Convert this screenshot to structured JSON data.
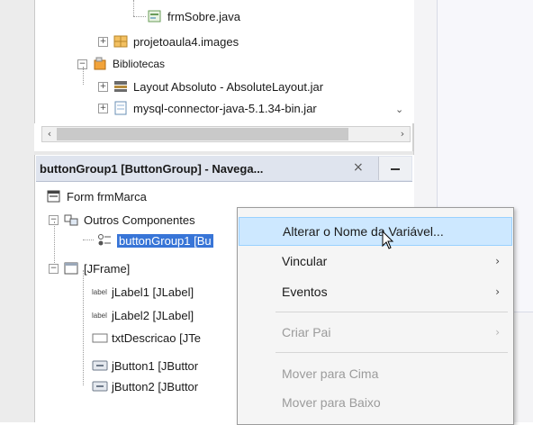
{
  "project_tree": {
    "items": [
      {
        "label": "frmSobre.java",
        "icon": "java-form-icon"
      },
      {
        "label": "projetoaula4.images",
        "icon": "package-icon"
      },
      {
        "label": "Bibliotecas",
        "icon": "libraries-icon"
      },
      {
        "label": "Layout Absoluto - AbsoluteLayout.jar",
        "icon": "jar-icon"
      },
      {
        "label": "mysql-connector-java-5.1.34-bin.jar",
        "icon": "jar-icon"
      }
    ]
  },
  "navigator": {
    "title": "buttonGroup1 [ButtonGroup] - Navega...",
    "close": "×",
    "minimize": "—",
    "items": [
      {
        "label": "Form frmMarca"
      },
      {
        "label": "Outros Componentes"
      },
      {
        "label": "buttonGroup1 [Bu"
      },
      {
        "label": "[JFrame]"
      },
      {
        "label": "jLabel1 [JLabel]",
        "tag": "label"
      },
      {
        "label": "jLabel2 [JLabel]",
        "tag": "label"
      },
      {
        "label": "txtDescricao [JTe"
      },
      {
        "label": "jButton1 [JButtor"
      },
      {
        "label": "jButton2 [JButtor"
      }
    ]
  },
  "context_menu": {
    "items": [
      {
        "label": "Alterar o Nome da Variável...",
        "enabled": true,
        "hover": true,
        "submenu": false
      },
      {
        "label": "Vincular",
        "enabled": true,
        "submenu": true
      },
      {
        "label": "Eventos",
        "enabled": true,
        "submenu": true
      },
      {
        "label": "Criar Pai",
        "enabled": false,
        "submenu": true
      },
      {
        "label": "Mover para Cima",
        "enabled": false,
        "submenu": false
      },
      {
        "label": "Mover para Baixo",
        "enabled": false,
        "submenu": false
      }
    ]
  },
  "colors": {
    "selection": "#3875d7",
    "menu_hover": "#cde8ff",
    "header": "#dfe4ee"
  }
}
